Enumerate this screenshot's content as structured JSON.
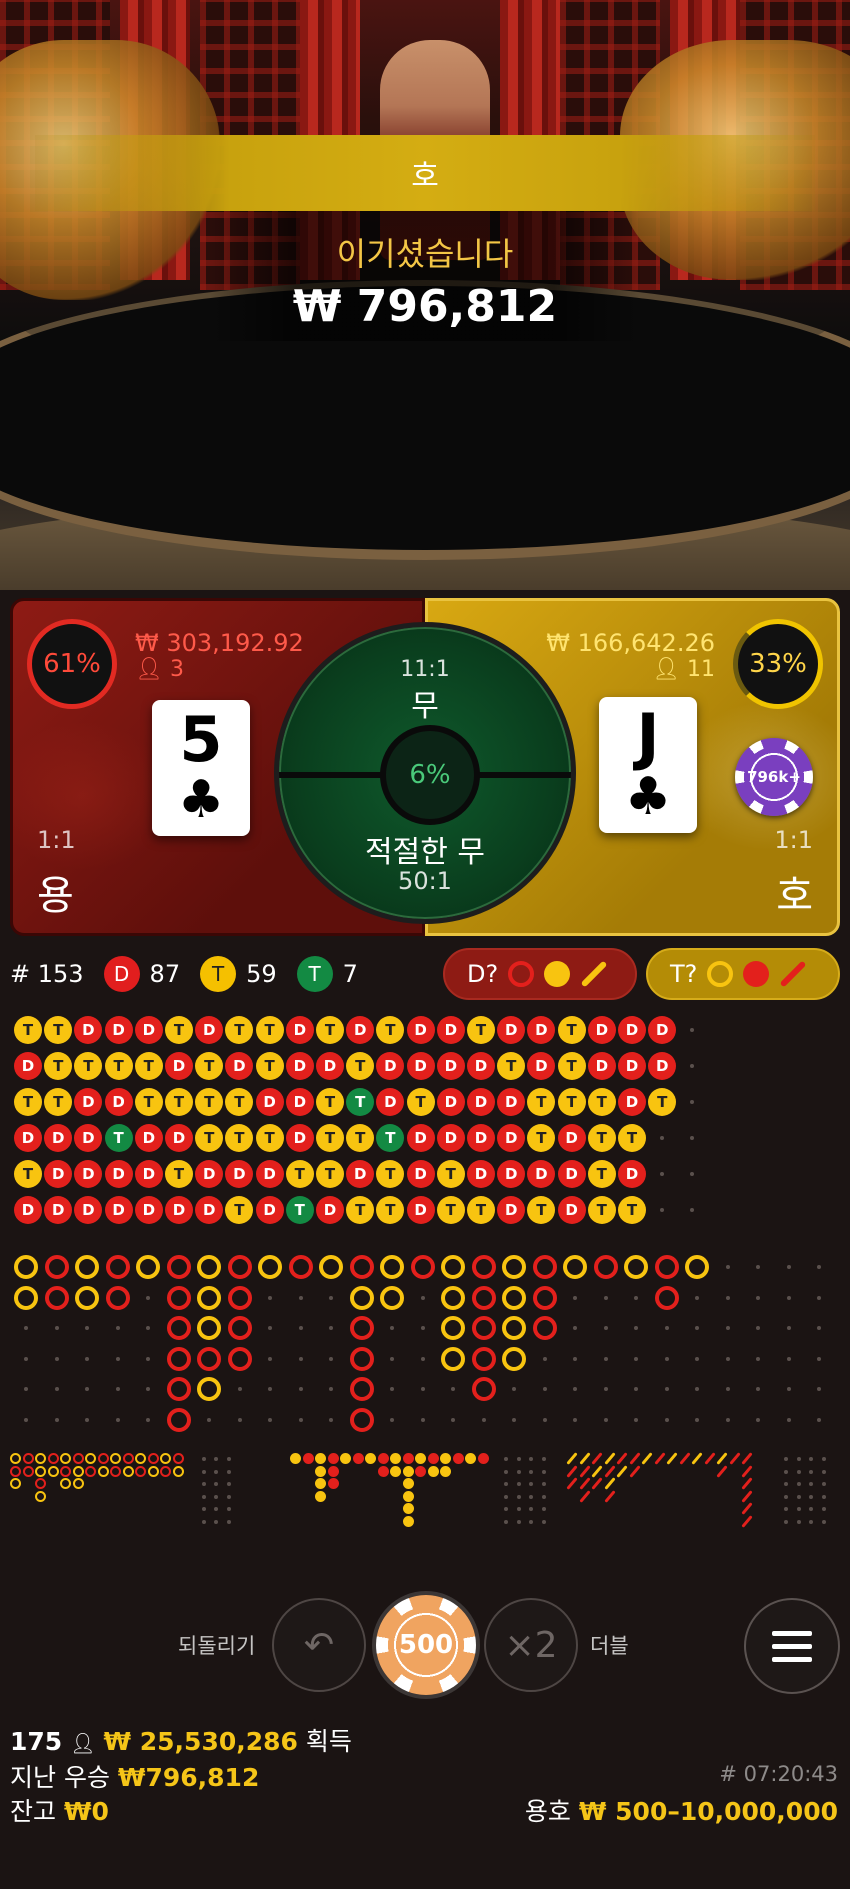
{
  "video": {
    "result_banner": "호",
    "win_text": "이기셨습니다",
    "win_amount": "₩ 796,812"
  },
  "board": {
    "dragon": {
      "percent": "61%",
      "stake": "₩ 303,192.92",
      "players": "3",
      "card_rank": "5",
      "card_suit": "♣",
      "odds": "1:1",
      "name": "용"
    },
    "tiger": {
      "percent": "33%",
      "stake": "₩ 166,642.26",
      "players": "11",
      "card_rank": "J",
      "card_suit": "♣",
      "odds": "1:1",
      "name": "호",
      "chip_label": "796k+"
    },
    "tie": {
      "odds": "11:1",
      "label": "무",
      "percent": "6%",
      "suited_label": "적절한 무",
      "suited_odds": "50:1"
    }
  },
  "stats": {
    "rounds_prefix": "# 153",
    "dragon_badge": "D",
    "dragon_count": "87",
    "tiger_badge": "T",
    "tiger_count": "59",
    "tie_badge": "T",
    "tie_count": "7",
    "predict_dragon": "D?",
    "predict_tiger": "T?"
  },
  "roads": {
    "bead_rows": [
      "TTDDDTDTTDTDTDDTDDTDDD",
      "DTTTTDTDTDDTDDDDTDTDDD",
      "TTDDTTTTDDTXDTDDDTTTDT",
      "DDDXDDTTTDTTXDDDDTDTT",
      "TDDDDTDDDTTDTDTDDDDTD",
      "DDDDDDDTDXDTTDTTDTDTT"
    ]
  },
  "controls": {
    "undo_label": "되돌리기",
    "undo_icon": "↶",
    "chip_value": "500",
    "double_icon": "×2",
    "double_label": "더블"
  },
  "footer": {
    "players_count": "175",
    "player_icon": "person-icon",
    "total_won": "₩ 25,530,286",
    "total_won_suffix": "획득",
    "last_win_label": "지난 우승",
    "last_win_value": "₩796,812",
    "balance_label": "잔고",
    "balance_value": "₩0",
    "round_id": "# 07:20:43",
    "limits_label": "용호",
    "limits_value": "₩ 500–10,000,000"
  },
  "colors": {
    "dragon": "#e3201c",
    "tiger": "#f8c410",
    "tie": "#138a43",
    "gold_text": "#f5c518"
  }
}
